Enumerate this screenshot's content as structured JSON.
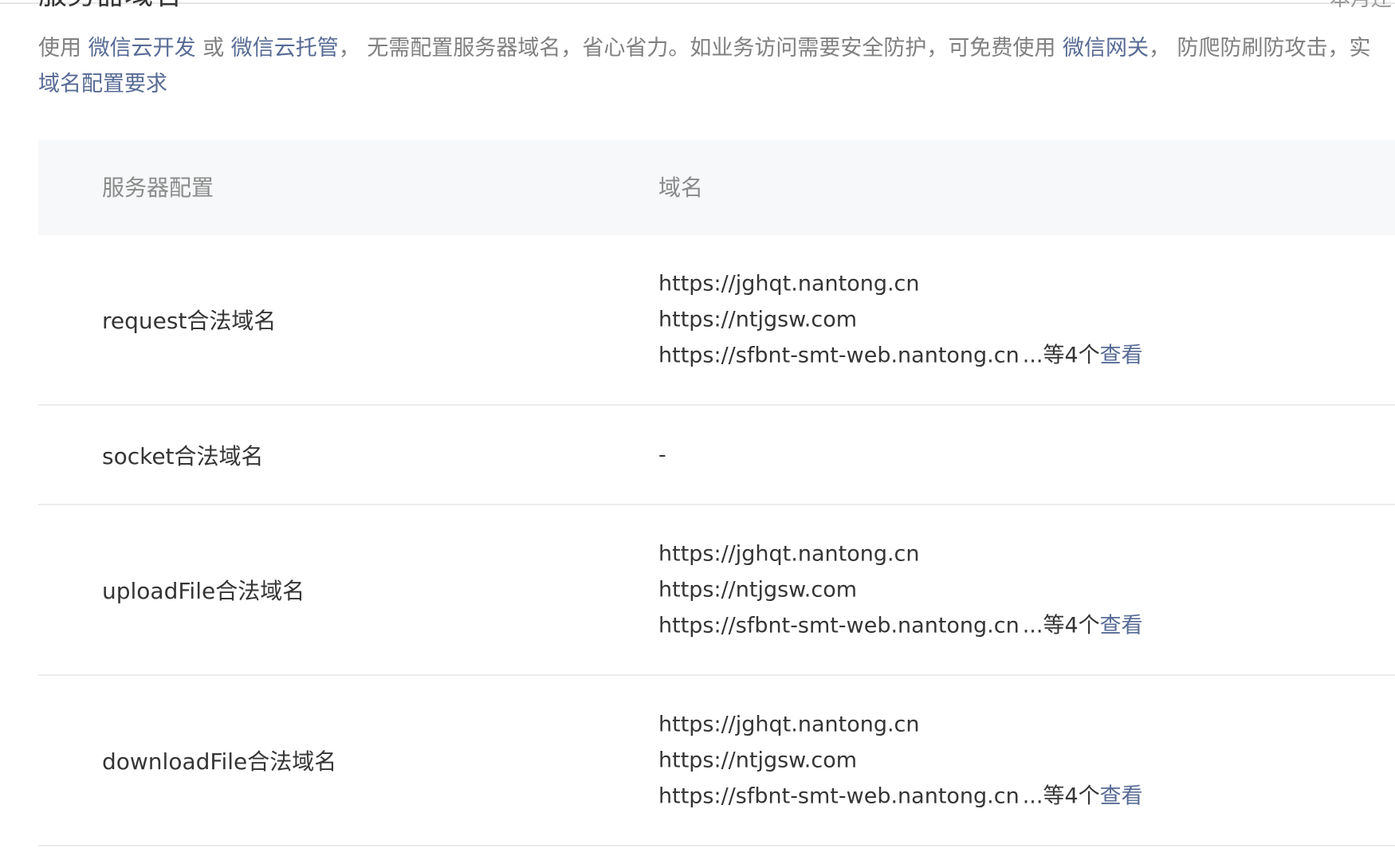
{
  "section": {
    "title": "服务器域名",
    "top_right_text": "本月还"
  },
  "description": {
    "line1": {
      "prefix": "使用",
      "link1": "微信云开发",
      "or": "或",
      "link2": "微信云托管",
      "middle": "，  无需配置服务器域名，省心省力。如业务访问需要安全防护，可免费使用",
      "link3": "微信网关",
      "suffix": "，  防爬防刷防攻击，实"
    },
    "line2_link": "域名配置要求"
  },
  "table": {
    "headers": [
      "服务器配置",
      "域名"
    ],
    "rows": [
      {
        "label": "request合法域名",
        "domains": [
          "https://jghqt.nantong.cn",
          "https://ntjgsw.com",
          "https://sfbnt-smt-web.nantong.cn"
        ],
        "more_text": "...等4个",
        "view_label": "查看"
      },
      {
        "label": "socket合法域名",
        "domains": [
          "-"
        ],
        "more_text": "",
        "view_label": ""
      },
      {
        "label": "uploadFile合法域名",
        "domains": [
          "https://jghqt.nantong.cn",
          "https://ntjgsw.com",
          "https://sfbnt-smt-web.nantong.cn"
        ],
        "more_text": "...等4个",
        "view_label": "查看"
      },
      {
        "label": "downloadFile合法域名",
        "domains": [
          "https://jghqt.nantong.cn",
          "https://ntjgsw.com",
          "https://sfbnt-smt-web.nantong.cn"
        ],
        "more_text": "...等4个",
        "view_label": "查看"
      }
    ]
  },
  "colors": {
    "link": "#576b95",
    "text": "#353535",
    "muted": "#808080",
    "header_bg": "#f6f8f9",
    "divider": "#ececec"
  }
}
